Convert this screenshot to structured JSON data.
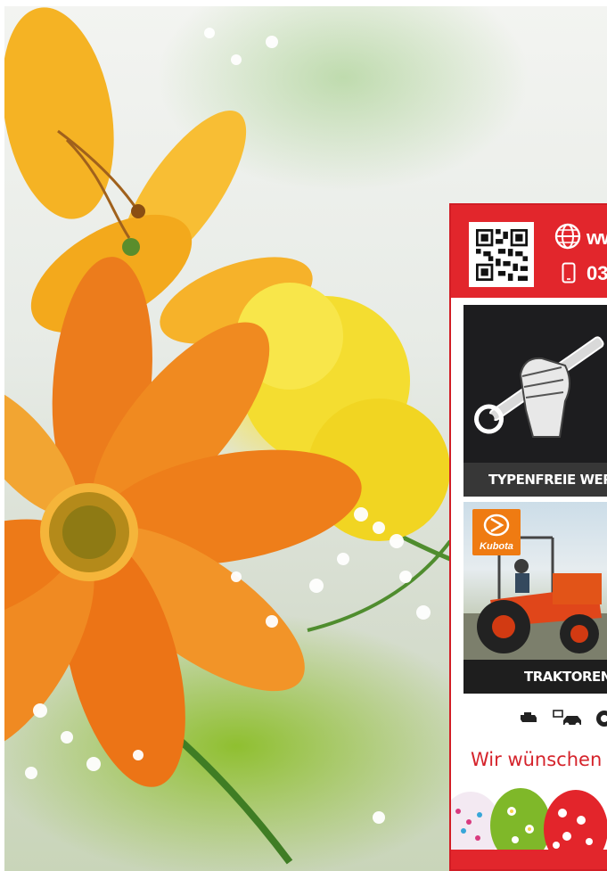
{
  "flyer": {
    "website_text": "ww",
    "phone_text": "03",
    "cards": [
      {
        "label": "TYPENFREIE WERKS",
        "icon": "wrench-fist-icon"
      },
      {
        "label": "TRAKTOREN",
        "brand": "Kubota",
        "icon": "tractor-image"
      }
    ],
    "service_icons": [
      "engine-icon",
      "car-diagnostics-icon",
      "tire-icon"
    ],
    "greeting": "Wir wünschen d",
    "colors": {
      "accent": "#e2262c",
      "kubota_orange": "#ef7b12"
    }
  }
}
